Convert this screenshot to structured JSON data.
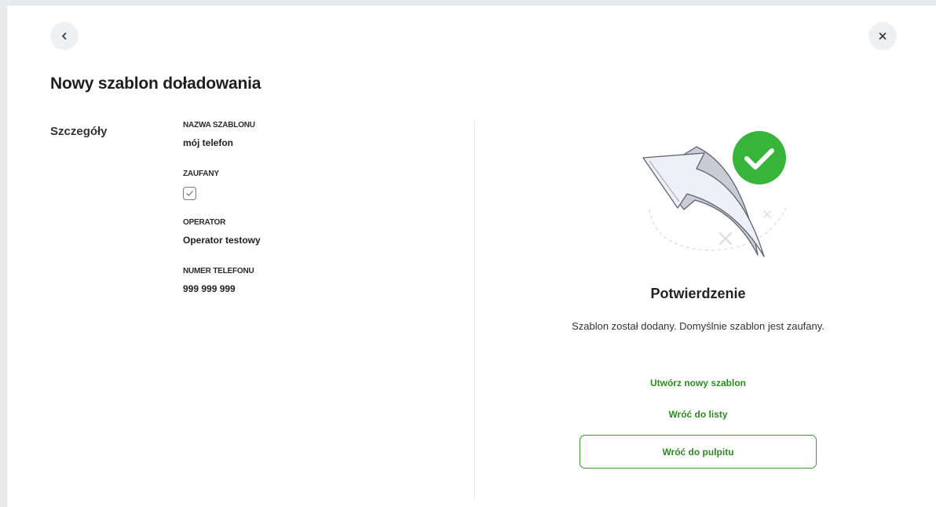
{
  "header": {
    "title": "Nowy szablon doładowania",
    "back_icon": "chevron-left-icon",
    "close_icon": "close-icon"
  },
  "details": {
    "section_label": "Szczegóły",
    "fields": [
      {
        "label": "NAZWA SZABLONU",
        "value": "mój telefon"
      },
      {
        "label": "ZAUFANY",
        "checked": true
      },
      {
        "label": "OPERATOR",
        "value": "Operator testowy"
      },
      {
        "label": "NUMER TELEFONU",
        "value": "999 999 999"
      }
    ]
  },
  "confirmation": {
    "illustration_icon": "return-arrow-success-icon",
    "title": "Potwierdzenie",
    "message": "Szablon został dodany. Domyślnie szablon jest zaufany.",
    "link_new": "Utwórz nowy szablon",
    "link_list": "Wróć do listy",
    "button_dashboard": "Wróć do pulpitu"
  },
  "colors": {
    "accent_green": "#2f8a23",
    "success_circle": "#37b43a",
    "background": "#ffffff"
  }
}
